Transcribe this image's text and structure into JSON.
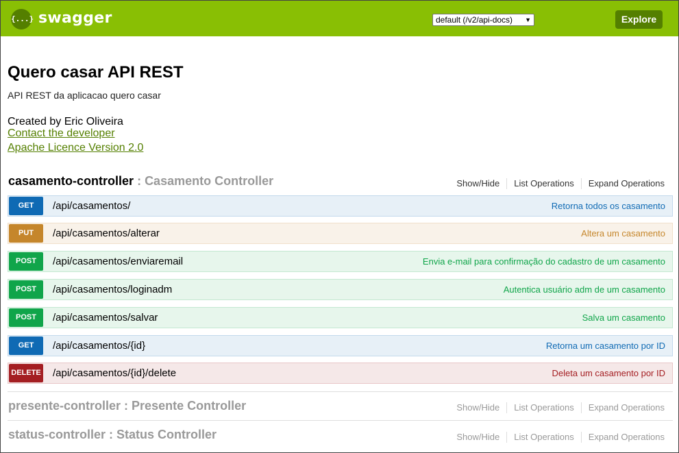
{
  "header": {
    "logo_glyph": "{...}",
    "brand": "swagger",
    "spec_select_value": "default (/v2/api-docs)",
    "explore_label": "Explore",
    "colors": {
      "bar": "#89bf04",
      "dark": "#547f00"
    }
  },
  "info": {
    "title": "Quero casar API REST",
    "description": "API REST da aplicacao quero casar",
    "created_by": "Created by Eric Oliveira",
    "contact_link": "Contact the developer",
    "license_link": "Apache Licence Version 2.0"
  },
  "controllers": [
    {
      "name": "casamento-controller",
      "sep": " : ",
      "desc": "Casamento Controller",
      "show_hide": "Show/Hide",
      "list_ops": "List Operations",
      "expand_ops": "Expand Operations",
      "operations": [
        {
          "method": "GET",
          "path": "/api/casamentos/",
          "summary": "Retorna todos os casamento"
        },
        {
          "method": "PUT",
          "path": "/api/casamentos/alterar",
          "summary": "Altera um casamento"
        },
        {
          "method": "POST",
          "path": "/api/casamentos/enviaremail",
          "summary": "Envia e-mail para confirmação do cadastro de um casamento"
        },
        {
          "method": "POST",
          "path": "/api/casamentos/loginadm",
          "summary": "Autentica usuário adm de um casamento"
        },
        {
          "method": "POST",
          "path": "/api/casamentos/salvar",
          "summary": "Salva um casamento"
        },
        {
          "method": "GET",
          "path": "/api/casamentos/{id}",
          "summary": "Retorna um casamento por ID"
        },
        {
          "method": "DELETE",
          "path": "/api/casamentos/{id}/delete",
          "summary": "Deleta um casamento por ID"
        }
      ]
    },
    {
      "name": "presente-controller",
      "sep": " : ",
      "desc": "Presente Controller",
      "show_hide": "Show/Hide",
      "list_ops": "List Operations",
      "expand_ops": "Expand Operations"
    },
    {
      "name": "status-controller",
      "sep": " : ",
      "desc": "Status Controller",
      "show_hide": "Show/Hide",
      "list_ops": "List Operations",
      "expand_ops": "Expand Operations"
    }
  ],
  "method_colors": {
    "GET": "#0f6ab4",
    "PUT": "#c5862b",
    "POST": "#10a54a",
    "DELETE": "#a41e22"
  }
}
